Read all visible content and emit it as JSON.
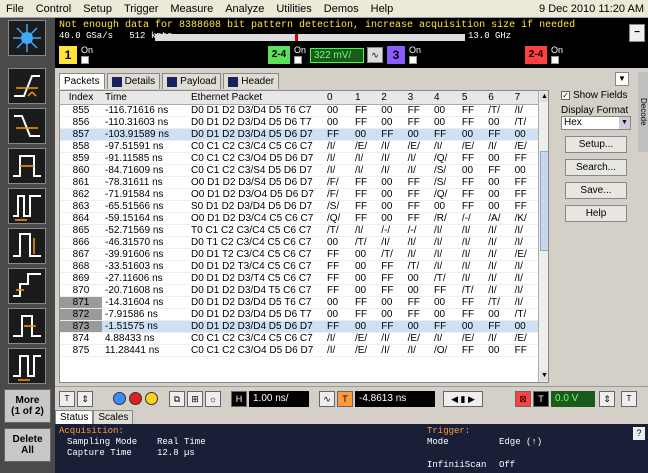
{
  "menu": {
    "items": [
      "File",
      "Control",
      "Setup",
      "Trigger",
      "Measure",
      "Analyze",
      "Utilities",
      "Demos",
      "Help"
    ],
    "date": "9 Dec 2010 11:20 AM"
  },
  "topband": {
    "warning": "Not enough data for 8388608 bit pattern detection, increase acquisition size if needed",
    "sample_rate": "40.0 GSa/s",
    "points": "512 kpts",
    "bandwidth": "13.0 GHz",
    "close_label": "−",
    "channels": [
      {
        "num": "1",
        "on_label": "On",
        "color": "#ffe23c"
      },
      {
        "num": "2-4",
        "on_label": "On",
        "color": "#5ce05c",
        "value": "322 mV/"
      },
      {
        "num": "3",
        "on_label": "On",
        "color": "#8a5cff"
      },
      {
        "num": "2-4",
        "on_label": "On",
        "color": "#ff4040"
      }
    ]
  },
  "tabs": [
    {
      "label": "Packets",
      "active": true
    },
    {
      "label": "Details",
      "active": false
    },
    {
      "label": "Payload",
      "active": false
    },
    {
      "label": "Header",
      "active": false
    }
  ],
  "table": {
    "columns": [
      "Index",
      "Time",
      "Ethernet Packet",
      "0",
      "1",
      "2",
      "3",
      "4",
      "5",
      "6",
      "7"
    ],
    "rows": [
      [
        "855",
        "-116.71616 ns",
        "D0 D1 D2 D3/D4 D5 T6 C7",
        "00",
        "FF",
        "00",
        "FF",
        "00",
        "FF",
        "/T/",
        "/I/"
      ],
      [
        "856",
        "-110.31603 ns",
        "D0 D1 D2 D3/D4 D5 D6 T7",
        "00",
        "FF",
        "00",
        "FF",
        "00",
        "FF",
        "00",
        "/T/"
      ],
      [
        "857",
        "-103.91589 ns",
        "D0 D1 D2 D3/D4 D5 D6 D7",
        "FF",
        "00",
        "FF",
        "00",
        "FF",
        "00",
        "FF",
        "00"
      ],
      [
        "858",
        "-97.51591 ns",
        "C0 C1 C2 C3/C4 C5 C6 C7",
        "/I/",
        "/E/",
        "/I/",
        "/E/",
        "/I/",
        "/E/",
        "/I/",
        "/E/"
      ],
      [
        "859",
        "-91.11585 ns",
        "C0 C1 C2 C3/O4 D5 D6 D7",
        "/I/",
        "/I/",
        "/I/",
        "/I/",
        "/Q/",
        "FF",
        "00",
        "FF"
      ],
      [
        "860",
        "-84.71609 ns",
        "C0 C1 C2 C3/S4 D5 D6 D7",
        "/I/",
        "/I/",
        "/I/",
        "/I/",
        "/S/",
        "00",
        "FF",
        "00"
      ],
      [
        "861",
        "-78.31611 ns",
        "O0 D1 D2 D3/S4 D5 D6 D7",
        "/F/",
        "FF",
        "00",
        "FF",
        "/S/",
        "FF",
        "00",
        "FF"
      ],
      [
        "862",
        "-71.91584 ns",
        "O0 D1 D2 D3/O4 D5 D6 D7",
        "/F/",
        "FF",
        "00",
        "FF",
        "/Q/",
        "FF",
        "00",
        "FF"
      ],
      [
        "863",
        "-65.51566 ns",
        "S0 D1 D2 D3/D4 D5 D6 D7",
        "/S/",
        "FF",
        "00",
        "FF",
        "00",
        "FF",
        "00",
        "FF"
      ],
      [
        "864",
        "-59.15164 ns",
        "O0 D1 D2 D3/C4 C5 C6 C7",
        "/Q/",
        "FF",
        "00",
        "FF",
        "/R/",
        "/-/",
        "/A/",
        "/K/"
      ],
      [
        "865",
        "-52.71569 ns",
        "T0 C1 C2 C3/C4 C5 C6 C7",
        "/T/",
        "/I/",
        "/-/",
        "/-/",
        "/I/",
        "/I/",
        "/I/",
        "/I/"
      ],
      [
        "866",
        "-46.31570 ns",
        "D0 T1 C2 C3/C4 C5 C6 C7",
        "00",
        "/T/",
        "/I/",
        "/I/",
        "/I/",
        "/I/",
        "/I/",
        "/I/"
      ],
      [
        "867",
        "-39.91606 ns",
        "D0 D1 T2 C3/C4 C5 C6 C7",
        "FF",
        "00",
        "/T/",
        "/I/",
        "/I/",
        "/I/",
        "/I/",
        "/E/"
      ],
      [
        "868",
        "-33.51603 ns",
        "D0 D1 D2 T3/C4 C5 C6 C7",
        "FF",
        "00",
        "FF",
        "/T/",
        "/I/",
        "/I/",
        "/I/",
        "/I/"
      ],
      [
        "869",
        "-27.11606 ns",
        "D0 D1 D2 D3/T4 C5 C6 C7",
        "FF",
        "00",
        "FF",
        "00",
        "/T/",
        "/I/",
        "/I/",
        "/I/"
      ],
      [
        "870",
        "-20.71608 ns",
        "D0 D1 D2 D3/D4 T5 C6 C7",
        "FF",
        "00",
        "FF",
        "00",
        "FF",
        "/T/",
        "/I/",
        "/I/"
      ],
      [
        "871",
        "-14.31604 ns",
        "D0 D1 D2 D3/D4 D5 T6 C7",
        "00",
        "FF",
        "00",
        "FF",
        "00",
        "FF",
        "/T/",
        "/I/"
      ],
      [
        "872",
        "-7.91586 ns",
        "D0 D1 D2 D3/D4 D5 D6 T7",
        "00",
        "FF",
        "00",
        "FF",
        "00",
        "FF",
        "00",
        "/T/"
      ],
      [
        "873",
        "-1.51575 ns",
        "D0 D1 D2 D3/D4 D5 D6 D7",
        "FF",
        "00",
        "FF",
        "00",
        "FF",
        "00",
        "FF",
        "00"
      ],
      [
        "874",
        "4.88433 ns",
        "C0 C1 C2 C3/C4 C5 C6 C7",
        "/I/",
        "/E/",
        "/I/",
        "/E/",
        "/I/",
        "/E/",
        "/I/",
        "/E/"
      ],
      [
        "875",
        "11.28441 ns",
        "C0 C1 C2 C3/O4 D5 D6 D7",
        "/I/",
        "/E/",
        "/I/",
        "/I/",
        "/O/",
        "FF",
        "00",
        "FF"
      ]
    ]
  },
  "right": {
    "show_fields_label": "Show Fields",
    "display_format_label": "Display Format",
    "format_value": "Hex",
    "buttons": [
      "Setup...",
      "Search...",
      "Save...",
      "Help"
    ],
    "decode_tab": "Decode",
    "menu_arrow": "▼"
  },
  "ctlbar": {
    "timebase": "1.00 ns/",
    "delay": "-4.8613 ns",
    "trigger_level": "0.0 V",
    "h_label": "H",
    "t_label": "T"
  },
  "left_toolbar": {
    "more_label": "More",
    "more_sub": "(1 of 2)",
    "delete_label": "Delete",
    "delete_sub": "All"
  },
  "status_tabs": [
    {
      "label": "Status",
      "active": true
    },
    {
      "label": "Scales",
      "active": false
    }
  ],
  "status": {
    "acq_heading": "Acquisition:",
    "sampling_mode_label": "Sampling Mode",
    "sampling_mode_value": "Real Time",
    "capture_time_label": "Capture Time",
    "capture_time_value": "12.8 µs",
    "trigger_heading": "Trigger:",
    "mode_label": "Mode",
    "mode_value": "Edge (↑)",
    "infiniiscan_label": "InfiniiScan",
    "infiniiscan_value": "Off",
    "help_btn": "?"
  },
  "colors": {
    "warning": "#ffe23c",
    "status_orange": "#ff9a3c",
    "highlight_row": "#cfe0f5"
  }
}
